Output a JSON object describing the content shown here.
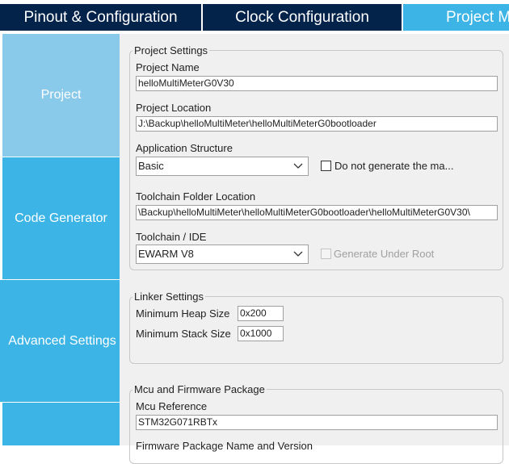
{
  "tabs": [
    {
      "label": "Pinout & Configuration"
    },
    {
      "label": "Clock Configuration"
    },
    {
      "label": "Project Manager"
    }
  ],
  "sidebar": {
    "items": [
      {
        "label": "Project",
        "active": true
      },
      {
        "label": "Code Generator"
      },
      {
        "label": "Advanced Settings"
      },
      {
        "label": ""
      }
    ]
  },
  "project_settings": {
    "legend": "Project Settings",
    "project_name_label": "Project Name",
    "project_name_value": "helloMultiMeterG0V30",
    "project_location_label": "Project Location",
    "project_location_value": "J:\\Backup\\helloMultiMeter\\helloMultiMeterG0bootloader",
    "app_structure_label": "Application Structure",
    "app_structure_value": "Basic",
    "do_not_generate_label": "Do not generate the ma...",
    "toolchain_folder_label": "Toolchain Folder Location",
    "toolchain_folder_value": "\\Backup\\helloMultiMeter\\helloMultiMeterG0bootloader\\helloMultiMeterG0V30\\",
    "toolchain_ide_label": "Toolchain / IDE",
    "toolchain_ide_value": "EWARM V8",
    "generate_under_root_label": "Generate Under Root"
  },
  "linker_settings": {
    "legend": "Linker Settings",
    "min_heap_label": "Minimum Heap Size",
    "min_heap_value": "0x200",
    "min_stack_label": "Minimum Stack Size",
    "min_stack_value": "0x1000"
  },
  "mcu_package": {
    "legend": "Mcu and Firmware Package",
    "mcu_reference_label": "Mcu Reference",
    "mcu_reference_value": "STM32G071RBTx",
    "firmware_name_label": "Firmware Package Name and Version"
  },
  "colors": {
    "tab_dark": "#03234b",
    "tab_active": "#3cb4e6",
    "sidebar_item": "#3cb4e6",
    "sidebar_active": "#89c9ea",
    "panel_bg": "#f0f0f0"
  }
}
